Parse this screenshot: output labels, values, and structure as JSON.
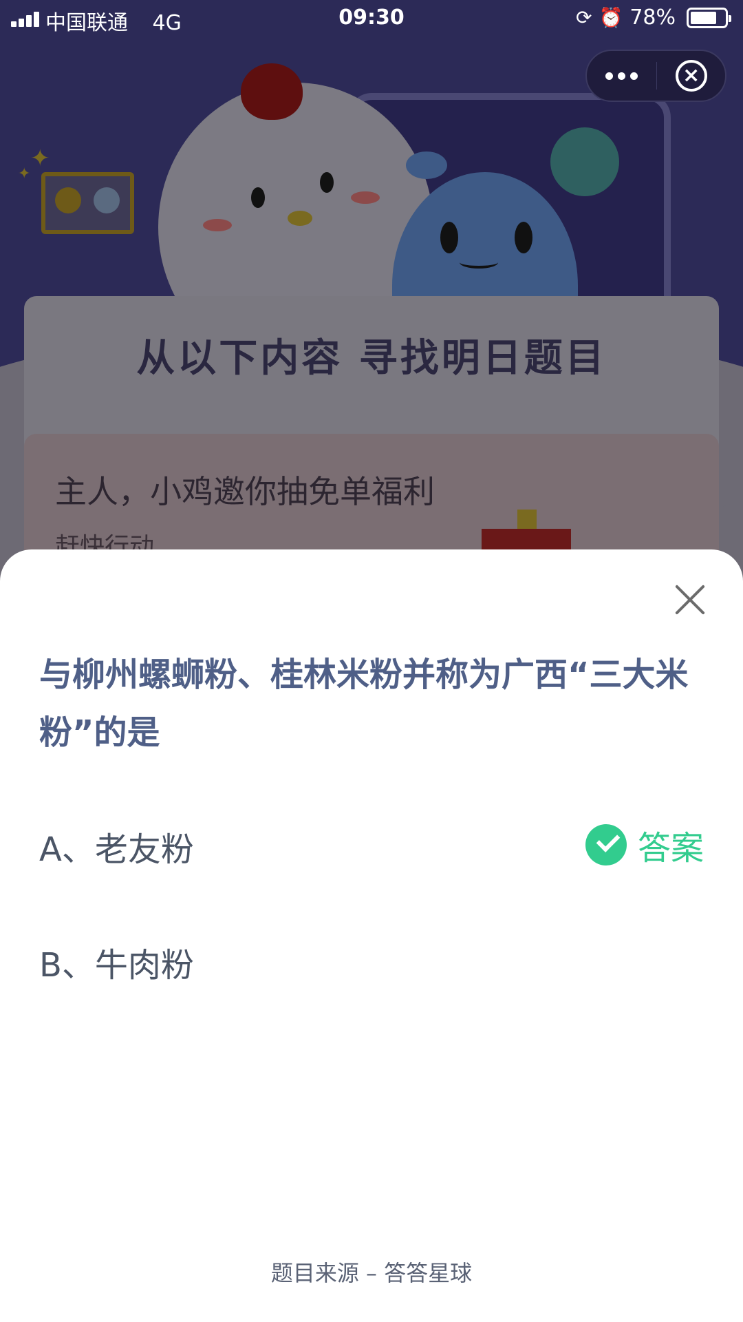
{
  "status_bar": {
    "carrier": "中国联通",
    "network": "4G",
    "time": "09:30",
    "battery": "78%",
    "battery_level": 0.78,
    "icons": [
      "signal-icon",
      "rotation-lock-icon",
      "alarm-icon",
      "battery-icon"
    ]
  },
  "capsule": {
    "more_icon": "more-dots-icon",
    "close_icon": "circle-close-icon"
  },
  "background": {
    "heading": "从以下内容 寻找明日题目",
    "promo_title": "主人，小鸡邀你抽免单福利",
    "promo_subtitle": "赶快行动"
  },
  "sheet": {
    "close_icon": "close-x-icon",
    "question": "与柳州螺蛳粉、桂林米粉并称为广西“三大米粉”的是",
    "options": [
      {
        "text": "A、老友粉",
        "is_answer": true
      },
      {
        "text": "B、牛肉粉",
        "is_answer": false
      }
    ],
    "answer_label": "答案",
    "answer_icon": "check-circle-icon",
    "answer_color": "#32CC8E",
    "source": "题目来源 – 答答星球"
  },
  "colors": {
    "question_text": "#4F5F87",
    "background_purple": "#2C2A57"
  }
}
